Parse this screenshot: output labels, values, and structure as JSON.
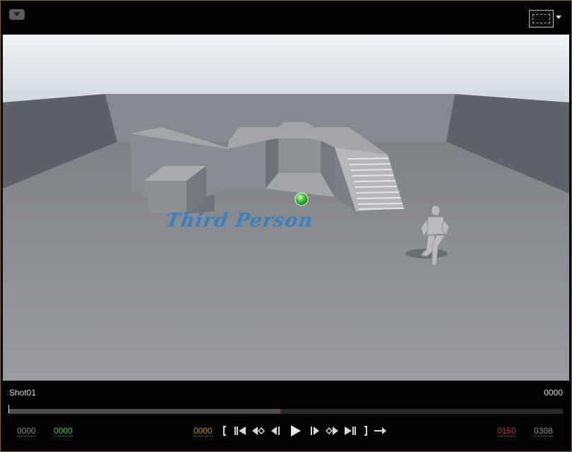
{
  "viewport": {
    "title": "Third Person",
    "accent_text_color": "#2e7fc4"
  },
  "sequencer": {
    "shot_name": "Shot01",
    "shot_current_frame": "0000",
    "playback_progress": 0.487,
    "timecodes": {
      "left_start": "0000",
      "left_green": "0000",
      "current": "0000",
      "end_red": "0150",
      "total": "0308"
    },
    "colors": {
      "start": "#8a8a8a",
      "green": "#3fc43f",
      "current": "#c8862a",
      "end": "#c03030",
      "total": "#8a8a8a"
    }
  },
  "icons": [
    "viewport-options-icon",
    "viewport-layout-icon",
    "jump-to-start-icon",
    "previous-key-icon",
    "add-key-icon",
    "step-back-icon",
    "play-icon",
    "step-forward-icon",
    "next-key-icon",
    "jump-to-end-icon",
    "set-end-icon",
    "loop-icon"
  ]
}
